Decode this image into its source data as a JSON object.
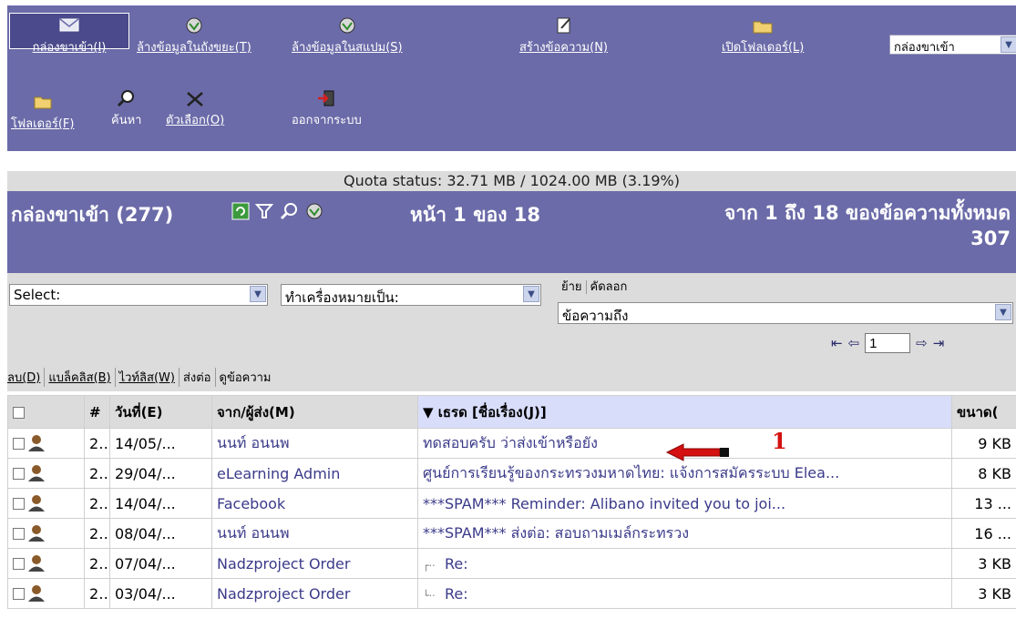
{
  "toolbar": {
    "inbox_label": "กล่องขาเข้า(I)",
    "empty_trash_label": "ล้างข้อมูลในถังขยะ(T)",
    "empty_spam_label": "ล้างข้อมูลในสแปม(S)",
    "compose_label": "สร้างข้อความ(N)",
    "open_folder_label": "เปิดโฟลเดอร์(L)",
    "folder_select_value": "กล่องขาเข้า",
    "folders_label": "โฟลเดอร์(F)",
    "search_label": "ค้นหา",
    "options_label": "ตัวเลือก(O)",
    "logout_label": "ออกจากระบบ"
  },
  "quota": "Quota status: 32.71 MB / 1024.00 MB (3.19%)",
  "folder": {
    "title": "กล่องขาเข้า (277)",
    "page_info": "หน้า 1 ของ 18",
    "range": "จาก 1 ถึง 18 ของข้อความทั้งหมด",
    "total": "307"
  },
  "actions": {
    "select_value": "Select:",
    "mark_as_value": "ทำเครื่องหมายเป็น:",
    "move_label": "ย้าย",
    "copy_label": "คัดลอก",
    "target_folder_value": "ข้อความถึง",
    "page_value": "1",
    "delete": "ลบ(D)",
    "blacklist": "แบล็คลิส(B)",
    "whitelist": "ไวท์ลิส(W)",
    "forward": "ส่งต่อ",
    "view": "ดูข้อความ"
  },
  "table": {
    "headers": {
      "num": "#",
      "date": "วันที่(E)",
      "from": "จาก/ผู้ส่ง(M)",
      "thread": "▼ เธรด  [ชื่อเรื่อง(J)]",
      "size": "ขนาด("
    },
    "rows": [
      {
        "num": "2...",
        "date": "14/05/...",
        "from": "นนท์ อนนพ",
        "subject": "ทดสอบครับ ว่าส่งเข้าหรือยัง",
        "size": "9 KB"
      },
      {
        "num": "2...",
        "date": "29/04/...",
        "from": "eLearning Admin",
        "subject": "ศูนย์การเรียนรู้ของกระทรวงมหาดไทย: แจ้งการสมัครระบบ Elea...",
        "size": "8 KB"
      },
      {
        "num": "2...",
        "date": "14/04/...",
        "from": "Facebook",
        "subject": "***SPAM*** Reminder: Alibano invited you to joi...",
        "size": "13 ..."
      },
      {
        "num": "2...",
        "date": "08/04/...",
        "from": "นนท์ อนนพ",
        "subject": "***SPAM*** ส่งต่อ: สอบถามเมล์กระทรวง",
        "size": "16 ..."
      },
      {
        "num": "2...",
        "date": "07/04/...",
        "from": "Nadzproject Order",
        "subject": "Re:",
        "size": "3 KB"
      },
      {
        "num": "2...",
        "date": "03/04/...",
        "from": "Nadzproject Order",
        "subject": "Re:",
        "size": "3 KB"
      }
    ]
  },
  "annotation": {
    "number": "1",
    "color": "#d41010"
  }
}
